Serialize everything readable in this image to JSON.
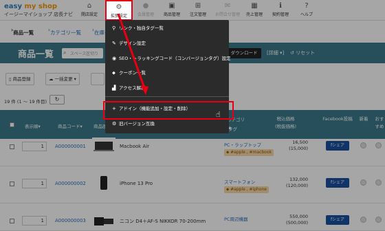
{
  "logo": {
    "brand_a": "easy",
    "brand_b": "my shop",
    "subtitle": "イージーマイショップ 店長ナビ"
  },
  "nav": [
    {
      "label": "開店設定",
      "icon": "home-icon"
    },
    {
      "label": "拡張設定",
      "icon": "gear-icon"
    },
    {
      "label": "会員管理",
      "icon": "person-icon"
    },
    {
      "label": "商品管理",
      "icon": "box-icon"
    },
    {
      "label": "注文管理",
      "icon": "cart-icon"
    },
    {
      "label": "お問合せ管理",
      "icon": "mail-icon"
    },
    {
      "label": "売上管理",
      "icon": "calculator-icon"
    },
    {
      "label": "契約管理",
      "icon": "info-icon"
    },
    {
      "label": "ヘルプ",
      "icon": "question-icon"
    }
  ],
  "subnav": [
    "商品一覧",
    "カテゴリ一覧",
    "在庫一"
  ],
  "header": {
    "title": "商品一覧",
    "search_placeholder": "スペース区切り",
    "download": "ダウンロード",
    "detail": "[詳細 ▾]",
    "reset": "↺ リセット"
  },
  "actions": {
    "register": "商品登録",
    "bulk_change": "一括変更 ▾"
  },
  "count_text": "19 件 (1 ～ 19 件目)",
  "table_headers": {
    "order": "表示順▾",
    "code": "商品コード▾",
    "image": "商品画",
    "category": "カテゴリ",
    "tag": "タグ",
    "price": "税込価格\n(税抜価格)",
    "facebook": "Facebook投稿",
    "new": "新着",
    "recommend": "おすすめ"
  },
  "rows": [
    {
      "qty": "1",
      "code": "A000000001",
      "name": "Macbook Air",
      "category": "PC・ラップトップ",
      "tags": "#apple , #macbook",
      "price": "16,500",
      "price_ex": "(15,000)",
      "share": "fシェア"
    },
    {
      "qty": "1",
      "code": "A000000002",
      "name": "iPhone 13 Pro",
      "category": "スマートフォン",
      "tags": "#apple , #iphone",
      "price": "132,000",
      "price_ex": "(120,000)",
      "share": "fシェア"
    },
    {
      "qty": "1",
      "code": "A000000003",
      "name": "ニコン D4＋AF-S NIKKOR 70-200mm",
      "category": "PC周辺機器",
      "tags": "",
      "price": "550,000",
      "price_ex": "(500,000)",
      "share": "fシェア"
    }
  ],
  "menu": [
    {
      "icon": "link-icon",
      "label": "リンク・独自タグ一覧"
    },
    {
      "icon": "brush-icon",
      "label": "デザイン設定"
    },
    {
      "icon": "target-icon",
      "label": "SEO・トラッキングコード（コンバージョンタグ）設定"
    },
    {
      "icon": "tag-icon",
      "label": "クーポン一覧"
    },
    {
      "icon": "chart-icon",
      "label": "アクセス解析"
    },
    {
      "icon": "plus-icon",
      "label": "アドイン（機能追加・設定・削除）"
    },
    {
      "icon": "gear-icon",
      "label": "旧バージョン互換"
    }
  ],
  "colors": {
    "accent": "#3c7a8c",
    "highlight": "#e60012",
    "link": "#2a6ebb"
  }
}
